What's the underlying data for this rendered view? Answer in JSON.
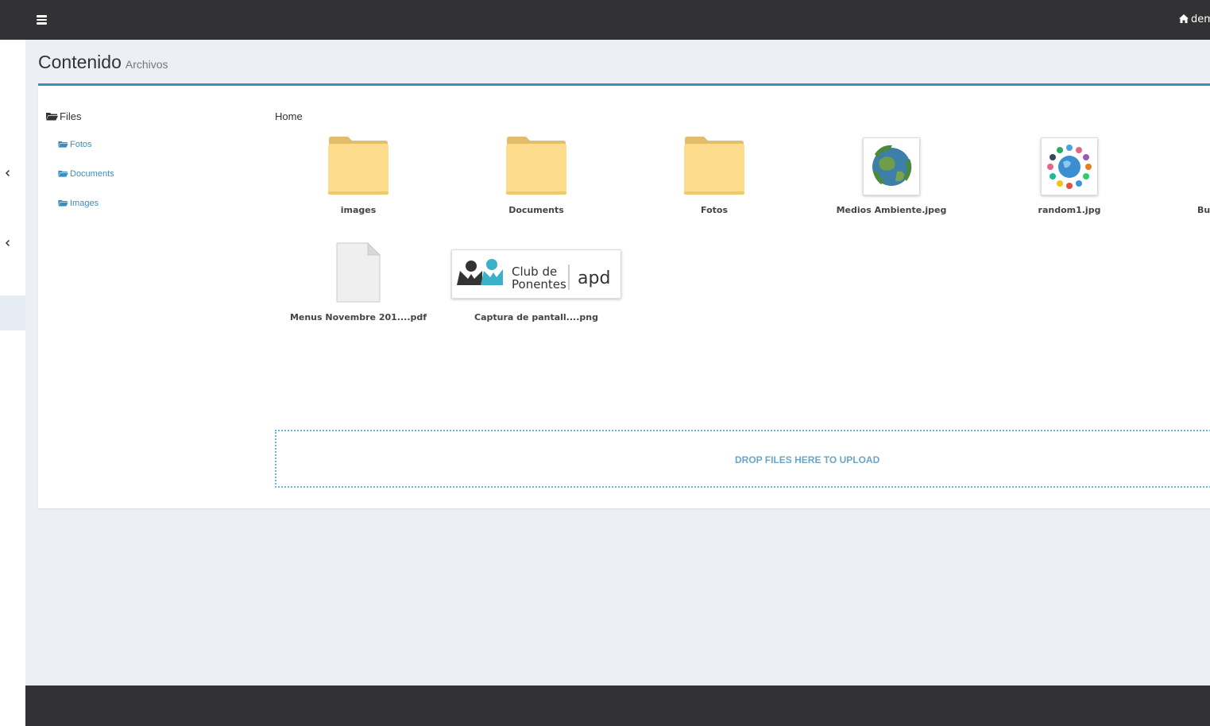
{
  "header": {
    "menu_icon": "hamburger-icon",
    "user_label": "demo",
    "home_icon": "home-icon"
  },
  "page": {
    "title": "Contenido",
    "subtitle": "Archivos"
  },
  "tree": {
    "root_label": "Files",
    "items": [
      {
        "label": "Fotos"
      },
      {
        "label": "Documents"
      },
      {
        "label": "Images"
      }
    ]
  },
  "breadcrumb": "Home",
  "files": [
    {
      "name": "images",
      "kind": "folder"
    },
    {
      "name": "Documents",
      "kind": "folder"
    },
    {
      "name": "Fotos",
      "kind": "folder"
    },
    {
      "name": "Medios Ambiente.jpeg",
      "kind": "image"
    },
    {
      "name": "random1.jpg",
      "kind": "image"
    },
    {
      "name": "Bu",
      "kind": "image"
    },
    {
      "name": "Menus Novembre 201....pdf",
      "kind": "document"
    },
    {
      "name": "Captura de pantall....png",
      "kind": "image"
    }
  ],
  "logo_text": {
    "line1": "Club de",
    "line2": "Ponentes",
    "brand": "apd"
  },
  "dropzone_label": "DROP FILES HERE TO UPLOAD",
  "colors": {
    "topbar": "#323133",
    "accent": "#3c8dbc",
    "folder": "#fddc8b"
  }
}
